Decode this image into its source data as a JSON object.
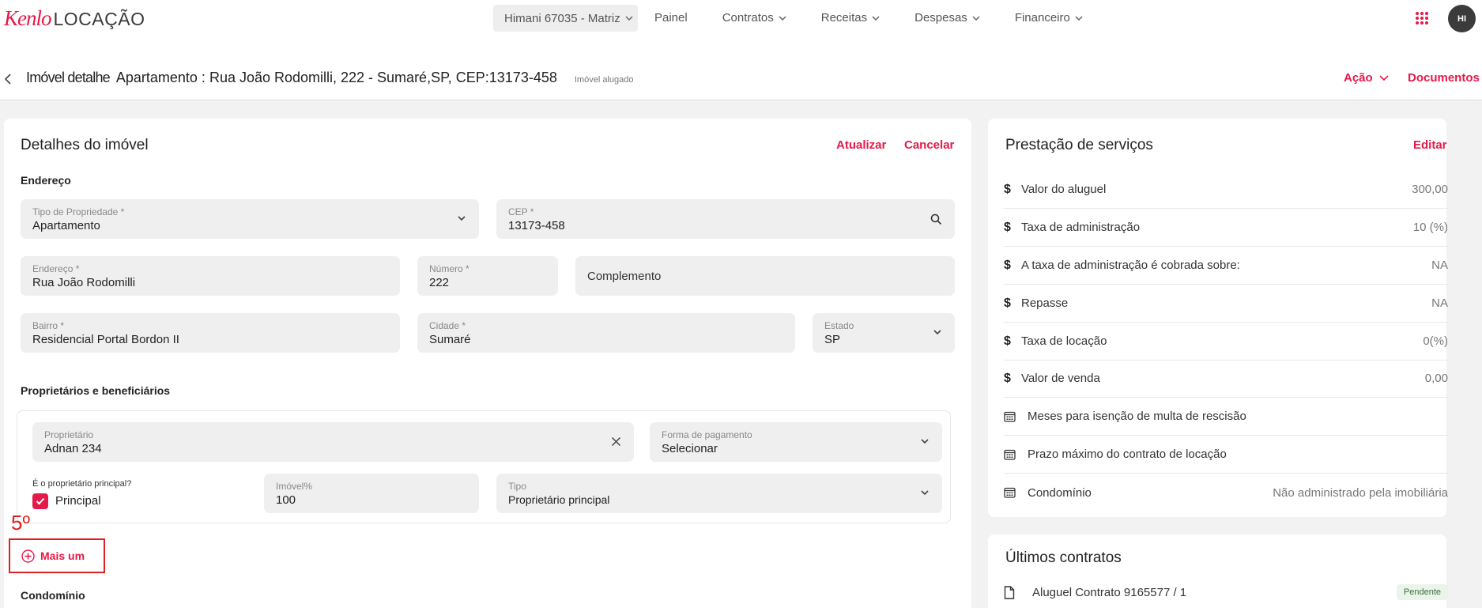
{
  "nav": {
    "logo_brand": "Kenlo",
    "logo_product": "LOCAÇÃO",
    "branch": "Himani 67035 - Matriz",
    "links": [
      {
        "label": "Painel",
        "dropdown": false
      },
      {
        "label": "Contratos",
        "dropdown": true
      },
      {
        "label": "Receitas",
        "dropdown": true
      },
      {
        "label": "Despesas",
        "dropdown": true
      },
      {
        "label": "Financeiro",
        "dropdown": true
      }
    ],
    "avatar": "HI"
  },
  "header": {
    "lead": "Imóvel detalhe",
    "title": "Apartamento : Rua João Rodomilli, 222 - Sumaré,SP, CEP:13173-458",
    "status": "Imóvel alugado",
    "action_label": "Ação",
    "documents_label": "Documentos"
  },
  "details": {
    "title": "Detalhes do imóvel",
    "update": "Atualizar",
    "cancel": "Cancelar",
    "address_section": "Endereço",
    "fields": {
      "tipo": {
        "label": "Tipo de Propriedade *",
        "value": "Apartamento"
      },
      "cep": {
        "label": "CEP *",
        "value": "13173-458"
      },
      "endereco": {
        "label": "Endereço *",
        "value": "Rua João Rodomilli"
      },
      "numero": {
        "label": "Número *",
        "value": "222"
      },
      "complemento": {
        "placeholder": "Complemento"
      },
      "bairro": {
        "label": "Bairro *",
        "value": "Residencial Portal Bordon II"
      },
      "cidade": {
        "label": "Cidade *",
        "value": "Sumaré"
      },
      "estado": {
        "label": "Estado",
        "value": "SP"
      }
    },
    "owners_section": "Proprietários e beneficiários",
    "owner": {
      "proprietario": {
        "label": "Proprietário",
        "value": "Adnan 234"
      },
      "forma": {
        "label": "Forma de pagamento",
        "value": "Selecionar"
      },
      "principal_question": "É o proprietário principal?",
      "principal_label": "Principal",
      "principal_checked": true,
      "percent": {
        "label": "Imóvel%",
        "value": "100"
      },
      "tipo": {
        "label": "Tipo",
        "value": "Proprietário principal"
      }
    },
    "annotation": "5º",
    "add_more": "Mais um",
    "condo_section": "Condomínio"
  },
  "services": {
    "title": "Prestação de serviços",
    "edit": "Editar",
    "rows": [
      {
        "icon": "dollar-icon",
        "label": "Valor do aluguel",
        "value": "300,00"
      },
      {
        "icon": "dollar-icon",
        "label": "Taxa de administração",
        "value": "10 (%)"
      },
      {
        "icon": "dollar-icon",
        "label": "A taxa de administração é cobrada sobre:",
        "value": "NA"
      },
      {
        "icon": "dollar-icon",
        "label": "Repasse",
        "value": "NA"
      },
      {
        "icon": "dollar-icon",
        "label": "Taxa de locação",
        "value": "0(%)"
      },
      {
        "icon": "dollar-icon",
        "label": "Valor de venda",
        "value": "0,00"
      },
      {
        "icon": "calendar-icon",
        "label": "Meses para isenção de multa de rescisão",
        "value": ""
      },
      {
        "icon": "calendar-icon",
        "label": "Prazo máximo do contrato de locação",
        "value": ""
      },
      {
        "icon": "calendar-icon",
        "label": "Condomínio",
        "value": "Não administrado pela imobiliária"
      }
    ]
  },
  "contracts": {
    "title": "Últimos contratos",
    "items": [
      {
        "label": "Aluguel Contrato 9165577 / 1",
        "status": "Pendente"
      }
    ]
  },
  "colors": {
    "accent": "#e5194a",
    "annotation": "#e02020"
  }
}
